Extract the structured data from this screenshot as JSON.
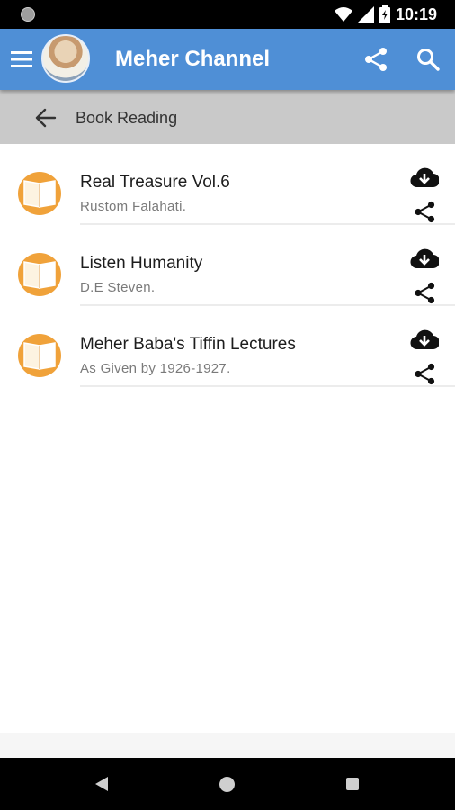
{
  "status_bar": {
    "time": "10:19"
  },
  "app_bar": {
    "title": "Meher Channel"
  },
  "sub_header": {
    "title": "Book Reading"
  },
  "books": [
    {
      "title": "Real Treasure Vol.6",
      "subtitle": "Rustom Falahati."
    },
    {
      "title": "Listen Humanity",
      "subtitle": "D.E Steven."
    },
    {
      "title": "Meher Baba's Tiffin Lectures",
      "subtitle": "As Given by 1926-1927."
    }
  ],
  "colors": {
    "app_bar": "#4f8fd6",
    "sub_header": "#c9c9c9",
    "book_icon": "#f0a23a"
  },
  "icons": {
    "app_bar": [
      "menu-icon",
      "share-icon",
      "search-icon"
    ],
    "book_row": [
      "book-icon",
      "cloud-download-icon",
      "share-icon"
    ],
    "nav": [
      "nav-back-icon",
      "nav-home-icon",
      "nav-recents-icon"
    ]
  }
}
